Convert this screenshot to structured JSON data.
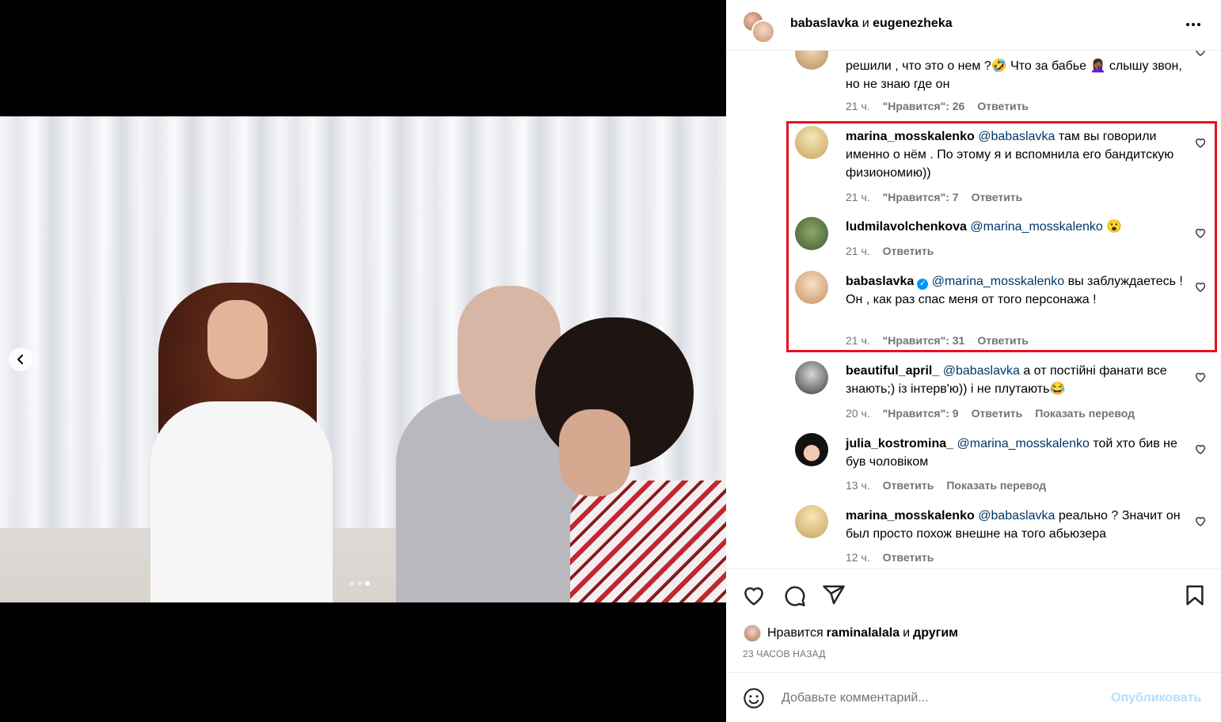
{
  "header": {
    "user1": "babaslavka",
    "conj": "и",
    "user2": "eugenezheka",
    "more_icon": "more-horizontal-icon"
  },
  "carousel": {
    "slides": 3,
    "active_slide": 3,
    "prev_icon": "chevron-left-icon"
  },
  "comments": [
    {
      "username": "",
      "text": "решили , что это о нем ?🤣 Что за бабье 🤦🏾‍♀️ слышу звон, но не знаю где он",
      "time": "21 ч.",
      "likes": "\"Нравится\": 26",
      "reply": "Ответить"
    },
    {
      "username": "marina_mosskalenko",
      "mention": "@babaslavka",
      "text": " там вы говорили именно о нём . По этому я и вспомнила его бандитскую физиономию))",
      "time": "21 ч.",
      "likes": "\"Нравится\": 7",
      "reply": "Ответить"
    },
    {
      "username": "ludmilavolchenkova",
      "mention": "@marina_mosskalenko",
      "text": " 😮",
      "time": "21 ч.",
      "reply": "Ответить"
    },
    {
      "username": "babaslavka",
      "verified": true,
      "mention": "@marina_mosskalenko",
      "text": " вы заблуждаетесь ! Он , как раз спас меня от того персонажа !",
      "time": "21 ч.",
      "likes": "\"Нравится\": 31",
      "reply": "Ответить"
    },
    {
      "username": "beautiful_april_",
      "mention": "@babaslavka",
      "text": " а от постійні фанати все знають;) із інтерв'ю)) і не плутають😂",
      "time": "20 ч.",
      "likes": "\"Нравится\": 9",
      "reply": "Ответить",
      "translate": "Показать перевод"
    },
    {
      "username": "julia_kostromina_",
      "mention": "@marina_mosskalenko",
      "text": " той хто бив не був чоловіком",
      "time": "13 ч.",
      "reply": "Ответить",
      "translate": "Показать перевод"
    },
    {
      "username": "marina_mosskalenko",
      "mention": "@babaslavka",
      "text": " реально ? Значит он был просто похож внешне на того абьюзера",
      "time": "12 ч.",
      "reply": "Ответить"
    }
  ],
  "actions": {
    "like_icon": "heart-icon",
    "comment_icon": "comment-icon",
    "share_icon": "send-icon",
    "save_icon": "bookmark-icon"
  },
  "likes_line": {
    "prefix": "Нравится",
    "user": "raminalalala",
    "suffix": "и",
    "others": "другим"
  },
  "posted_ago": "23 ЧАСОВ НАЗАД",
  "add_comment": {
    "placeholder": "Добавьте комментарий...",
    "post_label": "Опубликовать",
    "emoji_icon": "smiley-icon"
  },
  "colors": {
    "highlight": "#e8101f",
    "mention": "#00376b",
    "muted": "#737373",
    "post_disabled": "#b2dffc"
  }
}
